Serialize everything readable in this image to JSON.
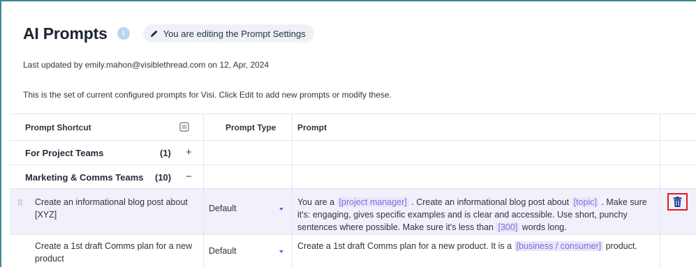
{
  "page": {
    "title": "AI Prompts",
    "info_badge": "i",
    "editing_notice": "You are editing the Prompt Settings",
    "last_updated": "Last updated by emily.mahon@visiblethread.com on 12, Apr, 2024",
    "description": "This is the set of current configured prompts for Visi. Click Edit to add new prompts or modify these."
  },
  "table": {
    "headers": {
      "shortcut": "Prompt Shortcut",
      "type": "Prompt Type",
      "prompt": "Prompt"
    },
    "groups": [
      {
        "label": "For Project Teams",
        "count": "(1)",
        "toggle": "+"
      },
      {
        "label": "Marketing & Comms Teams",
        "count": "(10)",
        "toggle": "−"
      }
    ],
    "rows": [
      {
        "shortcut": "Create an informational blog post about [XYZ]",
        "type": "Default",
        "prompt": {
          "t1": "You are a ",
          "tok1": "[project manager]",
          "t2": " . Create an informational blog post about ",
          "tok2": "[topic]",
          "t3": " . Make sure it's: engaging, gives specific examples and is clear and accessible. Use short, punchy sentences where possible. Make sure it's less than ",
          "tok3": "[300]",
          "t4": " words long."
        }
      },
      {
        "shortcut": "Create a 1st draft Comms plan for a new product",
        "type": "Default",
        "prompt": {
          "t1": "Create a 1st draft Comms plan for a new product. It is a ",
          "tok1": "[business / consumer]",
          "t2": " product."
        }
      }
    ]
  },
  "icons": {
    "info": "info-icon",
    "pencil": "pencil-icon",
    "collapse": "collapse-all-icon",
    "drag": "drag-handle-icon",
    "caret": "caret-down-icon",
    "trash": "trash-icon"
  },
  "colors": {
    "accent_token_bg": "#e8e6fa",
    "accent_token_text": "#7a6fdc",
    "trash_icon": "#1f3a9e",
    "highlight_box": "#e01c1c",
    "selected_row_bg": "#f1f0fb",
    "frame_border": "#3d8a8f"
  }
}
